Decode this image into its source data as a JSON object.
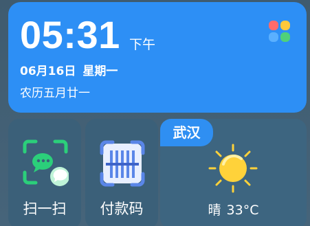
{
  "clock": {
    "time": "05:31",
    "ampm": "下午",
    "date": "06月16日",
    "weekday": "星期一",
    "lunar": "农历五月廿一",
    "logo_icon": "four-petal-app-logo-icon"
  },
  "shortcuts": [
    {
      "label": "扫一扫",
      "icon": "wechat-scan-icon"
    },
    {
      "label": "付款码",
      "icon": "payment-barcode-icon"
    }
  ],
  "weather": {
    "city": "武汉",
    "condition": "晴",
    "temperature": "33°C",
    "icon": "sun-icon"
  },
  "colors": {
    "accent": "#2d8ff5",
    "tile": "#3b6079",
    "scan_green": "#2bcf7a",
    "pay_blue": "#5a86e8",
    "sun_yellow": "#ffd23a"
  }
}
